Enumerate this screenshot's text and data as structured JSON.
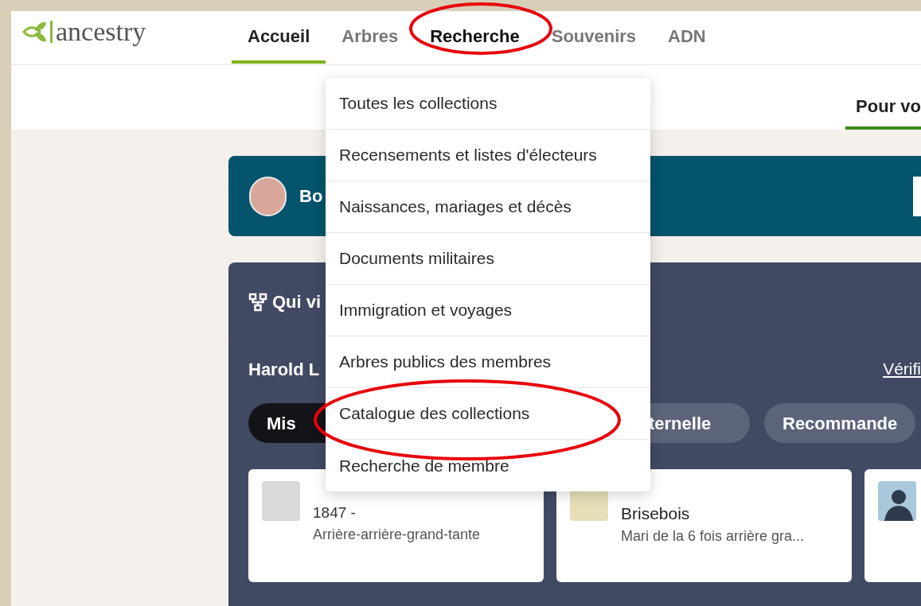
{
  "logo": "ancestry",
  "nav": [
    {
      "label": "Accueil",
      "selected": true,
      "expanded": false
    },
    {
      "label": "Arbres",
      "selected": false,
      "expanded": false
    },
    {
      "label": "Recherche",
      "selected": false,
      "expanded": true
    },
    {
      "label": "Souvenirs",
      "selected": false,
      "expanded": false
    },
    {
      "label": "ADN",
      "selected": false,
      "expanded": false
    }
  ],
  "sub_tabs": [
    {
      "label": "Pour vo",
      "selected": true
    }
  ],
  "banner": {
    "greeting": "Bo"
  },
  "family_panel": {
    "title": "Qui vi",
    "person": "Harold L",
    "link": "Vérifi",
    "filters": [
      {
        "label": "Mis",
        "selected": true
      },
      {
        "label": "ternelle",
        "selected": false
      },
      {
        "label": "Recommande",
        "selected": false
      }
    ],
    "cards": [
      {
        "kind": "record",
        "dates": "1847 -",
        "relation": "Arrière-arrière-grand-tante"
      },
      {
        "kind": "record",
        "name": "Brisebois",
        "relation": "Mari de la 6 fois arrière gra..."
      },
      {
        "kind": "person"
      }
    ]
  },
  "search_menu": {
    "items": [
      "Toutes les collections",
      "Recensements et listes d'électeurs",
      "Naissances, mariages et décès",
      "Documents militaires",
      "Immigration et voyages",
      "Arbres publics des membres",
      "Catalogue des collections",
      "Recherche de membre"
    ]
  }
}
